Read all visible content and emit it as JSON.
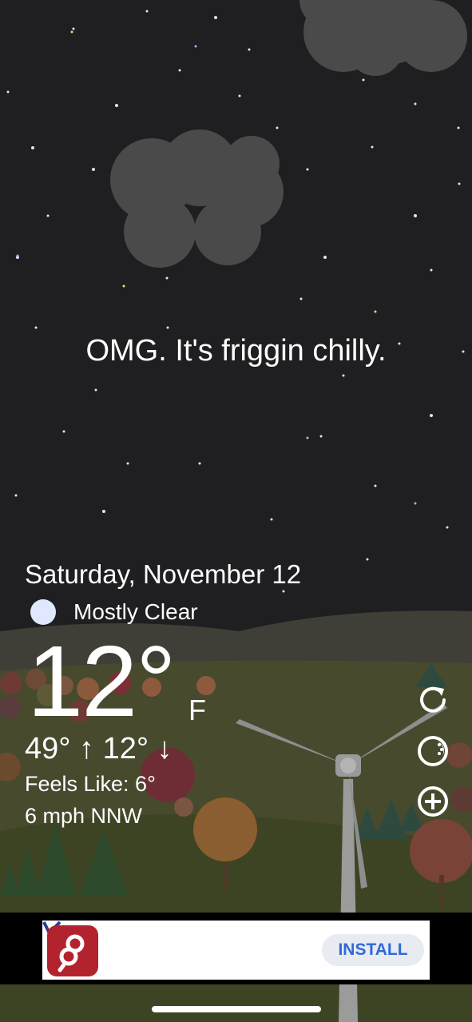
{
  "message": "OMG. It's friggin chilly.",
  "weather": {
    "date": "Saturday, November 12",
    "condition": "Mostly Clear",
    "condition_icon": "moon-icon",
    "temperature": "12°",
    "unit": "F",
    "high_low": "49° ↑ 12° ↓",
    "feels_like": "Feels Like: 6°",
    "wind": "6 mph NNW"
  },
  "actions": [
    {
      "icon": "refresh-icon"
    },
    {
      "icon": "appearance-icon"
    },
    {
      "icon": "add-icon"
    }
  ],
  "ad": {
    "button_label": "INSTALL",
    "logo_icon": "app-logo-icon"
  },
  "colors": {
    "sky": "#1f1f21",
    "hill_far": "#3f3f37",
    "hill_near": "#474a2d",
    "ground": "#3d4424",
    "install_text": "#3169d8",
    "ad_logo": "#b3232e"
  }
}
